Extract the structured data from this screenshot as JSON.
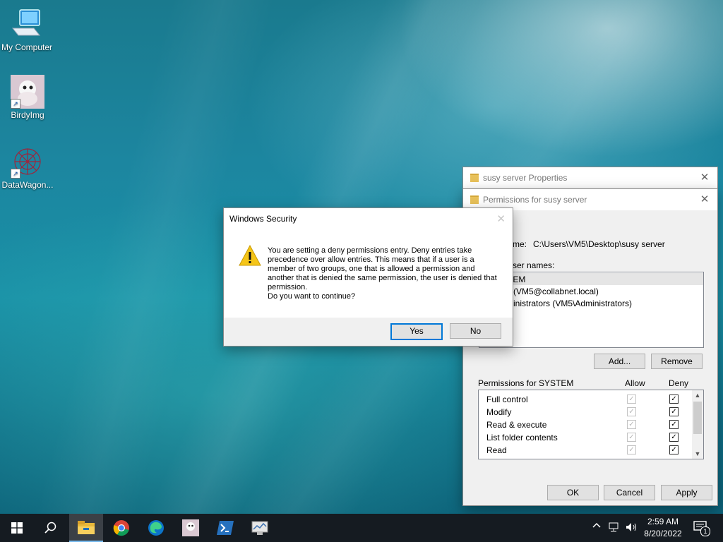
{
  "desktop": {
    "icons": [
      {
        "label": "My Computer",
        "icon": "computer-icon"
      },
      {
        "label": "BirdyImg",
        "icon": "image-shortcut-icon"
      },
      {
        "label": "DataWagon...",
        "icon": "network-shortcut-icon"
      }
    ]
  },
  "properties_window": {
    "title": "susy server Properties",
    "close": "✕"
  },
  "permissions_window": {
    "title": "Permissions for susy server",
    "close": "✕",
    "object_name_label": "me:",
    "object_name_value": "C:\\Users\\VM5\\Desktop\\susy server",
    "group_label": "ser names:",
    "users": [
      "TEM",
      "(VM5@collabnet.local)",
      "inistrators (VM5\\Administrators)"
    ],
    "add_label": "Add...",
    "remove_label": "Remove",
    "perm_header": "Permissions for SYSTEM",
    "allow_header": "Allow",
    "deny_header": "Deny",
    "permissions": [
      {
        "name": "Full control",
        "allow": true,
        "deny": true
      },
      {
        "name": "Modify",
        "allow": true,
        "deny": true
      },
      {
        "name": "Read & execute",
        "allow": true,
        "deny": true
      },
      {
        "name": "List folder contents",
        "allow": true,
        "deny": true
      },
      {
        "name": "Read",
        "allow": true,
        "deny": true
      }
    ],
    "ok_label": "OK",
    "cancel_label": "Cancel",
    "apply_label": "Apply"
  },
  "security_dialog": {
    "title": "Windows Security",
    "close": "✕",
    "message": "You are setting a deny permissions entry. Deny entries take precedence over allow entries. This means that if a user is a member of two groups, one that is allowed a permission and another that is denied the same permission, the user is denied that permission.",
    "question": "Do you want to continue?",
    "yes_label": "Yes",
    "no_label": "No",
    "icon": "warning-icon"
  },
  "taskbar": {
    "apps": [
      "start-icon",
      "search-icon",
      "file-explorer-icon",
      "chrome-icon",
      "edge-icon",
      "birdyimg-icon",
      "powershell-icon",
      "network-tool-icon"
    ],
    "time": "2:59 AM",
    "date": "8/20/2022",
    "notification_count": "1"
  },
  "colors": {
    "accent": "#0078d7",
    "warning": "#f5c518",
    "taskbar": "#151b21"
  }
}
